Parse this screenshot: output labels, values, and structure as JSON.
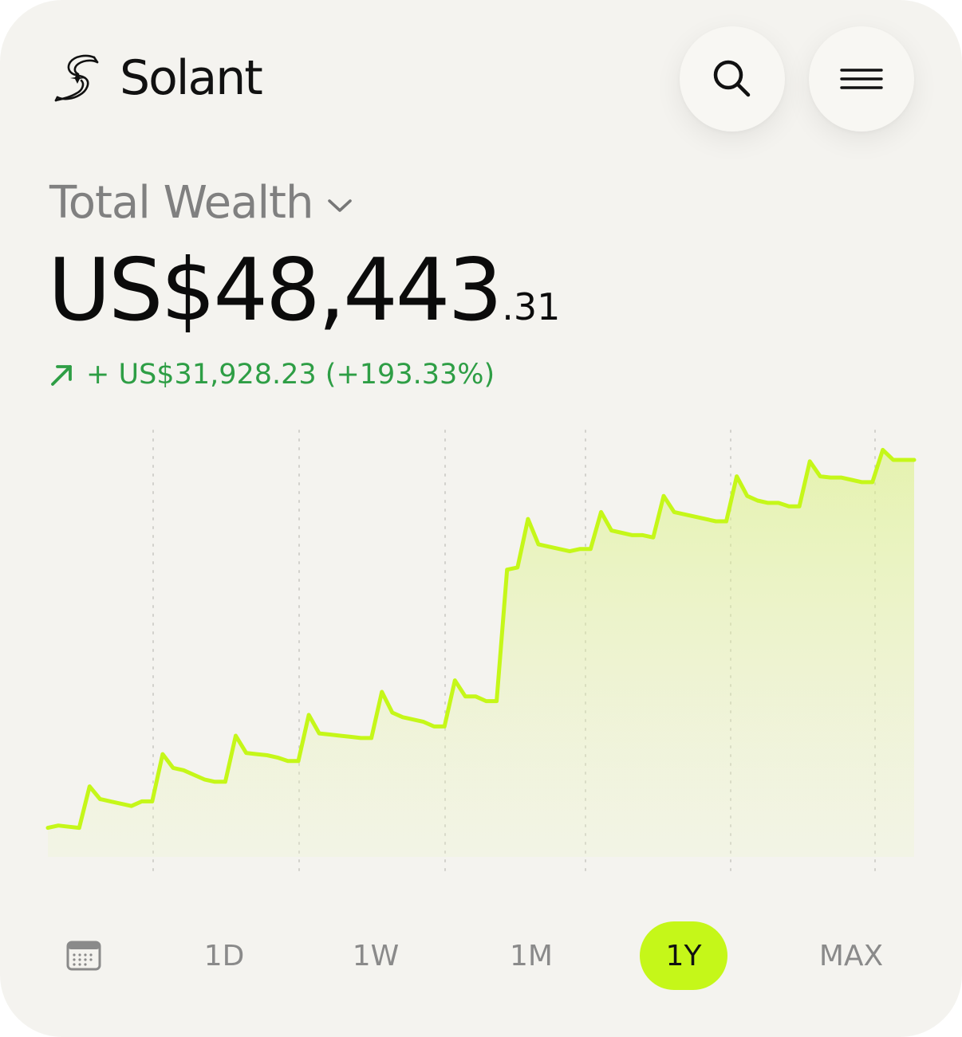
{
  "brand": {
    "name": "Solant"
  },
  "header": {
    "search_icon": "search-icon",
    "menu_icon": "hamburger-menu-icon"
  },
  "summary": {
    "label": "Total Wealth",
    "amount_main": "US$48,443",
    "amount_cents": ".31",
    "change_text": "+ US$31,928.23 (+193.33%)",
    "change_color": "#2e9e45"
  },
  "ranges": {
    "items": [
      "1D",
      "1W",
      "1M",
      "1Y",
      "MAX"
    ],
    "selected": "1Y",
    "accent_color": "#c5f719"
  },
  "chart_data": {
    "type": "area",
    "color": "#c5f719",
    "grid": "vertical-dotted",
    "xlabel": "",
    "ylabel": "",
    "values": [
      16515,
      16715,
      16615,
      16515,
      20115,
      19015,
      18815,
      18615,
      18415,
      18815,
      18815,
      22915,
      21715,
      21515,
      21115,
      20715,
      20515,
      20515,
      24515,
      23015,
      22915,
      22815,
      22615,
      22315,
      22315,
      26315,
      24715,
      24615,
      24515,
      24415,
      24315,
      24315,
      28315,
      26515,
      26115,
      25915,
      25715,
      25315,
      25315,
      29315,
      27915,
      27915,
      27515,
      27515,
      38915,
      39115,
      43315,
      41115,
      40915,
      40715,
      40515,
      40715,
      40715,
      43915,
      42315,
      42115,
      41915,
      41915,
      41715,
      45315,
      43915,
      43715,
      43515,
      43315,
      43115,
      43115,
      47015,
      45315,
      44915,
      44715,
      44715,
      44415,
      44415,
      48315,
      47015,
      46915,
      46915,
      46715,
      46515,
      46515,
      49315,
      48443,
      48443,
      48443
    ],
    "ylim": [
      14000,
      51000
    ]
  }
}
